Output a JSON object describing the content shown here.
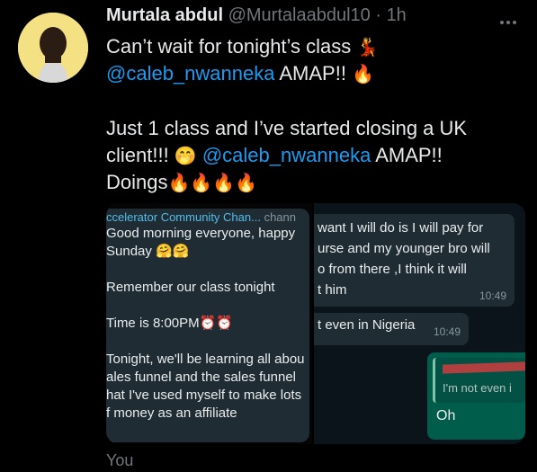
{
  "tweet": {
    "author_name": "Murtala abdul",
    "author_handle": "@Murtalaabdul10",
    "separator": "·",
    "time": "1h",
    "line1": "Can’t wait for tonight’s class",
    "line2_mention": "@caleb_nwanneka",
    "line2_rest": " AMAP!!",
    "line4": "Just 1 class and I’ve started closing a UK",
    "line5_start": "client!!! ",
    "line5_mention": "@caleb_nwanneka",
    "line5_rest": " AMAP!!",
    "line6": "Doings",
    "emoji_dancer": "💃",
    "emoji_fire": "🔥",
    "emoji_hand": "🤭",
    "emoji_fire4": "🔥🔥🔥🔥"
  },
  "screenshot_left": {
    "channel_title": "ccelerator Community Chan...",
    "channel_sub": "chann",
    "lines": [
      "Good morning everyone, happy",
      "Sunday 🤗🤗",
      "Remember our class tonight",
      "Time is 8:00PM⏰⏰",
      "Tonight, we'll be learning all abou",
      "ales funnel and the sales funnel",
      "hat I've used myself to make lots",
      "f money as an affiliate"
    ]
  },
  "screenshot_right": {
    "msg1_lines": [
      "want I will do is I will pay for",
      "urse and my younger bro will",
      "o from there ,I think it will",
      "t him"
    ],
    "msg1_time": "10:49",
    "msg2": "t even in Nigeria",
    "msg2_time": "10:49",
    "quoted_text": "I'm not even i",
    "reply": "Oh"
  },
  "footer": {
    "label": "You"
  },
  "colors": {
    "mention": "#1d9bf0",
    "background": "#000000",
    "secondary_text": "#71767b"
  }
}
